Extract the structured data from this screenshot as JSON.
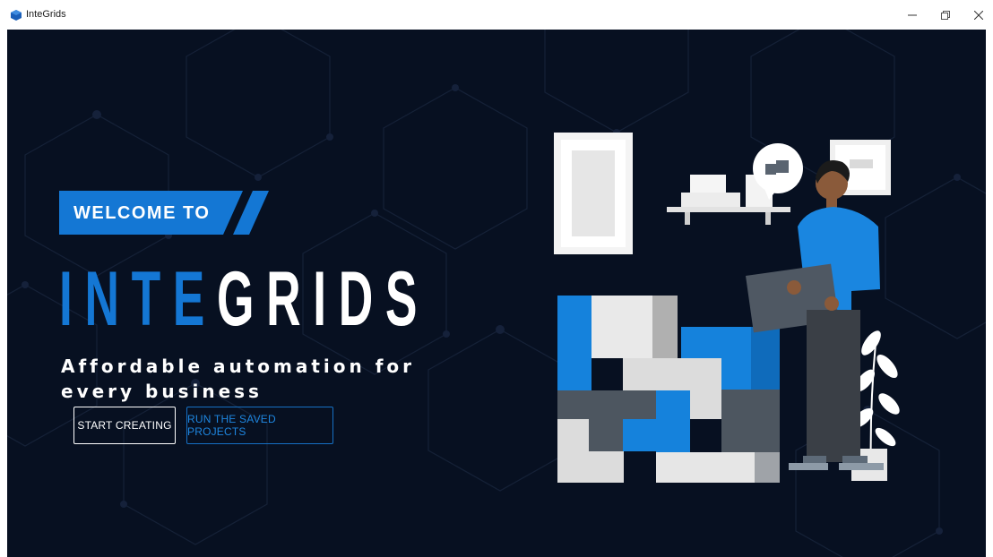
{
  "window": {
    "title": "InteGrids",
    "icon": "app-logo-icon",
    "controls": [
      "minimize-icon",
      "maximize-icon",
      "close-icon"
    ]
  },
  "hero": {
    "welcome_label": "WELCOME TO",
    "brand_part1": "INTE",
    "brand_part2": "GRIDS",
    "tagline": "Affordable automation for every business"
  },
  "actions": {
    "start_label": "START CREATING",
    "run_saved_label": "RUN THE SAVED PROJECTS"
  },
  "colors": {
    "background": "#071021",
    "accent": "#1477d4",
    "text": "#ffffff"
  }
}
